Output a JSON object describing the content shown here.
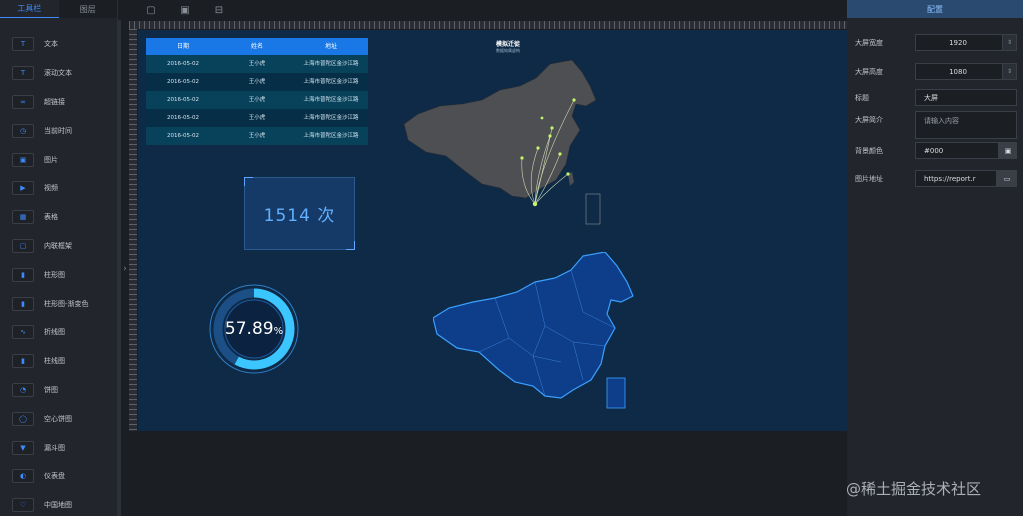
{
  "left_tabs": [
    "工具栏",
    "图层"
  ],
  "tools": [
    {
      "icon": "text-icon",
      "glyph": "T",
      "label": "文本"
    },
    {
      "icon": "marquee-text-icon",
      "glyph": "T",
      "label": "滚动文本"
    },
    {
      "icon": "link-icon",
      "glyph": "∞",
      "label": "超链接"
    },
    {
      "icon": "clock-icon",
      "glyph": "◷",
      "label": "当前时间"
    },
    {
      "icon": "image-icon",
      "glyph": "▣",
      "label": "图片"
    },
    {
      "icon": "video-icon",
      "glyph": "▶",
      "label": "视频"
    },
    {
      "icon": "table-icon",
      "glyph": "▦",
      "label": "表格"
    },
    {
      "icon": "iframe-icon",
      "glyph": "▢",
      "label": "内联框架"
    },
    {
      "icon": "bar-chart-icon",
      "glyph": "▮",
      "label": "柱形图"
    },
    {
      "icon": "gradient-bar-icon",
      "glyph": "▮",
      "label": "柱形图-渐变色"
    },
    {
      "icon": "line-chart-icon",
      "glyph": "∿",
      "label": "折线图"
    },
    {
      "icon": "combo-chart-icon",
      "glyph": "▮",
      "label": "柱线图"
    },
    {
      "icon": "pie-icon",
      "glyph": "◔",
      "label": "饼图"
    },
    {
      "icon": "donut-icon",
      "glyph": "◯",
      "label": "空心饼图"
    },
    {
      "icon": "funnel-icon",
      "glyph": "▼",
      "label": "漏斗图"
    },
    {
      "icon": "gauge-icon",
      "glyph": "◐",
      "label": "仪表盘"
    },
    {
      "icon": "china-map-icon",
      "glyph": "♡",
      "label": "中国地图"
    }
  ],
  "toolbar_icons": [
    "save-icon",
    "screenshot-icon",
    "preview-icon"
  ],
  "table": {
    "headers": [
      "日期",
      "姓名",
      "地址"
    ],
    "rows": [
      [
        "2016-05-02",
        "王小虎",
        "上海市普陀区金沙江路"
      ],
      [
        "2016-05-02",
        "王小虎",
        "上海市普陀区金沙江路"
      ],
      [
        "2016-05-02",
        "王小虎",
        "上海市普陀区金沙江路"
      ],
      [
        "2016-05-02",
        "王小虎",
        "上海市普陀区金沙江路"
      ],
      [
        "2016-05-02",
        "王小虎",
        "上海市普陀区金沙江路"
      ]
    ]
  },
  "counter": "1514 次",
  "gauge": {
    "value": "57.89",
    "unit": "%",
    "fraction": 0.5789
  },
  "map": {
    "title": "模拟迁徙",
    "subtitle": "数据纯属虚构"
  },
  "right": {
    "title": "配置",
    "props": [
      {
        "label": "大屏宽度",
        "value": "1920",
        "kind": "number"
      },
      {
        "label": "大屏高度",
        "value": "1080",
        "kind": "number"
      },
      {
        "label": "标题",
        "value": "大屏",
        "kind": "text"
      },
      {
        "label": "大屏简介",
        "value": "请输入内容",
        "kind": "textarea"
      },
      {
        "label": "背景颜色",
        "value": "#000",
        "kind": "color"
      },
      {
        "label": "图片地址",
        "value": "https://report.r",
        "kind": "file"
      }
    ]
  },
  "watermark": "@稀土掘金技术社区",
  "colors": {
    "accent": "#3d8bff",
    "canvas": "#0e2a47",
    "gauge": "#3cc6ff"
  }
}
